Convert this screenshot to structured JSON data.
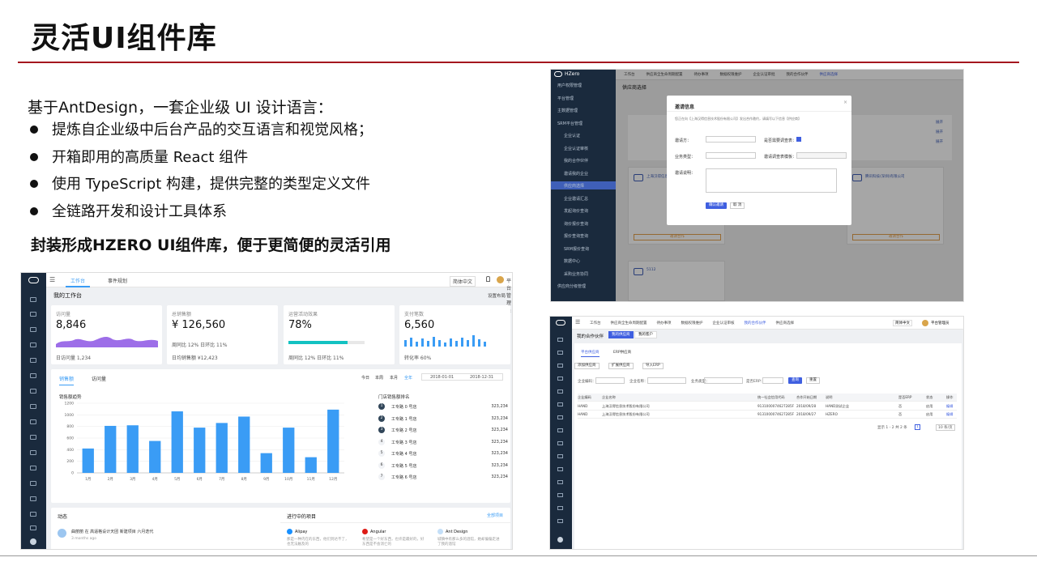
{
  "title": "灵活UI组件库",
  "intro": "基于AntDesign，一套企业级 UI 设计语言：",
  "bullets": [
    "提炼自企业级中后台产品的交互语言和视觉风格；",
    "开箱即用的高质量 React 组件",
    "使用 TypeScript 构建，提供完整的类型定义文件",
    "全链路开发和设计工具体系"
  ],
  "slogan": "封装形成HZERO UI组件库，便于更简便的灵活引用",
  "accent_color": "#a4161f",
  "dashboard": {
    "tabs": [
      "工作台",
      "事件规划"
    ],
    "lang": "简体中文",
    "user": "平台管理员",
    "page_title": "我的工作台",
    "settings": "设置布局",
    "kpis": [
      {
        "label": "访问量",
        "value": "8,846",
        "foot": "日访问量  1,234"
      },
      {
        "label": "总销售额",
        "value": "¥ 126,560",
        "foot": "日均销售额  ¥12,423",
        "sub": "周同比 12%   日环比 11%"
      },
      {
        "label": "运营活动效果",
        "value": "78%",
        "sub": "周同比 12%   日环比 11%"
      },
      {
        "label": "支付笔数",
        "value": "6,560",
        "foot": "转化率  60%"
      }
    ],
    "chart_tabs": [
      "销售额",
      "访问量"
    ],
    "range_tabs": [
      "今日",
      "本周",
      "本月",
      "全年"
    ],
    "date_from": "2018-01-01",
    "date_to": "2018-12-31",
    "chart_title": "销售额趋势",
    "rank_title": "门店销售额排名",
    "rank": [
      {
        "n": "1",
        "name": "工专路 0 号店",
        "v": "323,234"
      },
      {
        "n": "2",
        "name": "工专路 1 号店",
        "v": "323,234"
      },
      {
        "n": "3",
        "name": "工专路 2 号店",
        "v": "323,234"
      },
      {
        "n": "4",
        "name": "工专路 3 号店",
        "v": "323,234"
      },
      {
        "n": "5",
        "name": "工专路 4 号店",
        "v": "323,234"
      },
      {
        "n": "6",
        "name": "工专路 5 号店",
        "v": "323,234"
      },
      {
        "n": "7",
        "name": "工专路 6 号店",
        "v": "323,234"
      }
    ],
    "bottom_left_title": "动态",
    "activity_text": "曲丽丽 在 高逼格设计天团 新建项目 六月迭代",
    "activity_time": "3 months ago",
    "bottom_right_title": "进行中的项目",
    "all_projects": "全部项目",
    "projects": [
      "Alipay",
      "Angular",
      "Ant Design"
    ],
    "project_desc": [
      "那是一种内在的东西，他们到达不了，也无法触及的",
      "希望是一个好东西，也许是最好的，好东西是不会消亡的",
      "城镇中有那么多的酒馆，她却偏偏走进了我的酒馆"
    ]
  },
  "chart_data": {
    "type": "bar",
    "title": "销售额趋势",
    "categories": [
      "1月",
      "2月",
      "3月",
      "4月",
      "5月",
      "6月",
      "7月",
      "8月",
      "9月",
      "10月",
      "11月",
      "12月"
    ],
    "values": [
      420,
      810,
      820,
      550,
      1060,
      780,
      860,
      970,
      340,
      780,
      270,
      1090
    ],
    "ylim": [
      0,
      1200
    ],
    "yticks": [
      0,
      200,
      400,
      600,
      800,
      1000,
      1200
    ],
    "color": "#3a9cf5"
  },
  "supplier": {
    "brand": "HZero",
    "tabs": [
      "工作台",
      "供应商全生命周期配置",
      "待办事项",
      "数据权限维护",
      "企业认证审批",
      "我的合作伙伴",
      "供应商选择"
    ],
    "page_title": "供应商选择",
    "dialog_title": "邀请信息",
    "dialog_hint": "您正在向【上海汉得信息技术股份有限公司】发出合作邀约，请填写以下信息【供应商】",
    "fields": [
      "邀请方：",
      "业务类型：",
      "邀请说明：",
      "是否需要调查表：",
      "邀请调查表模板："
    ],
    "ok": "确认邀请",
    "cancel": "取 消",
    "sidebar": [
      "用户权限管理",
      "平台管理",
      "主数据管理",
      "SRM平台管理",
      "企业认证",
      "企业认证审核",
      "我的合作伙伴",
      "邀请我的企业",
      "供应商选择",
      "企业邀请汇总",
      "发起询价查询",
      "询价报价查询",
      "报价查询查询",
      "SRM报价查询",
      "数据中心",
      "采购业务协同",
      "供应商分级管理"
    ],
    "cards": [
      "上海汉得信息技术股份有限公司",
      "腾讯科技(深圳)有限公司",
      "5112"
    ],
    "expand": "展开",
    "card_btn": "邀请合作"
  },
  "partners": {
    "tabs": [
      "工作台",
      "供应商全生命周期配置",
      "待办事项",
      "数据权限维护",
      "企业认证审核",
      "我的合作伙伴",
      "供应商选择"
    ],
    "page_title": "我的合作伙伴",
    "switch": [
      "我的供应商",
      "我的客户"
    ],
    "sub_tabs": [
      "平台供应商",
      "ERP供应商"
    ],
    "buttons": [
      "添加供应商",
      "扩展供应商",
      "导入ERP"
    ],
    "filters": [
      "企业编码：",
      "企业名称：",
      "业务类型：",
      "是否ERP："
    ],
    "query": "查询",
    "reset": "重置",
    "headers": [
      "企业编码",
      "企业名称",
      "统一社会信用代码",
      "合作开始日期",
      "说明",
      "是否ERP",
      "状态",
      "操作"
    ],
    "rows": [
      [
        "HAND",
        "上海汉得信息技术股份有限公司",
        "9131000074627285F",
        "2018/09/28",
        "HAND测试企业",
        "否",
        "启用",
        "编辑"
      ],
      [
        "HAND",
        "上海汉得信息技术股份有限公司",
        "9131000074627285F",
        "2018/09/27",
        "HZERO",
        "否",
        "启用",
        "编辑"
      ]
    ],
    "pager": "显示 1 - 2 共 2 条",
    "page_size": "10 条/页"
  }
}
